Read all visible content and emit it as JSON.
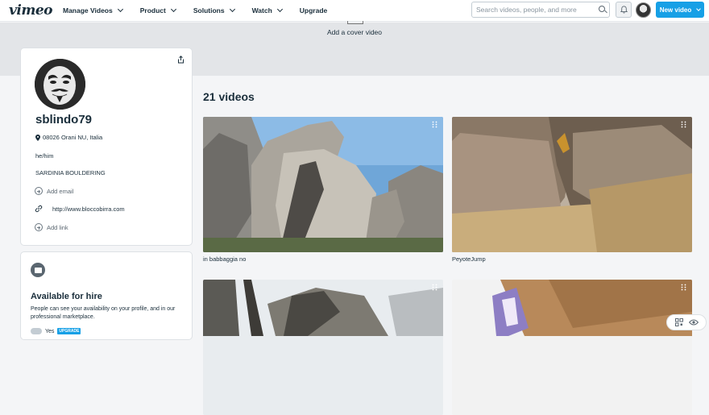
{
  "header": {
    "logo": "vimeo",
    "nav": [
      "Manage Videos",
      "Product",
      "Solutions",
      "Watch",
      "Upgrade"
    ],
    "search_placeholder": "Search videos, people, and more",
    "new_video_label": "New video"
  },
  "cover": {
    "label": "Add a cover video"
  },
  "profile": {
    "username": "sblindo79",
    "location": "08026 Orani NU, Italia",
    "pronouns": "he/him",
    "bio": "SARDINIA BOULDERING",
    "add_email": "Add email",
    "website": "http://www.bloccobirra.com",
    "add_link": "Add link"
  },
  "hire": {
    "title": "Available for hire",
    "description": "People can see your availability on your profile, and in our professional marketplace.",
    "toggle_label": "Yes",
    "badge": "UPGRADE"
  },
  "videos": {
    "count_label": "21 videos",
    "items": [
      {
        "title": "in babbaggia no"
      },
      {
        "title": "PeyoteJump"
      },
      {
        "title": ""
      },
      {
        "title": ""
      }
    ]
  },
  "colors": {
    "accent": "#17a0e6",
    "text": "#1a2e3b"
  }
}
